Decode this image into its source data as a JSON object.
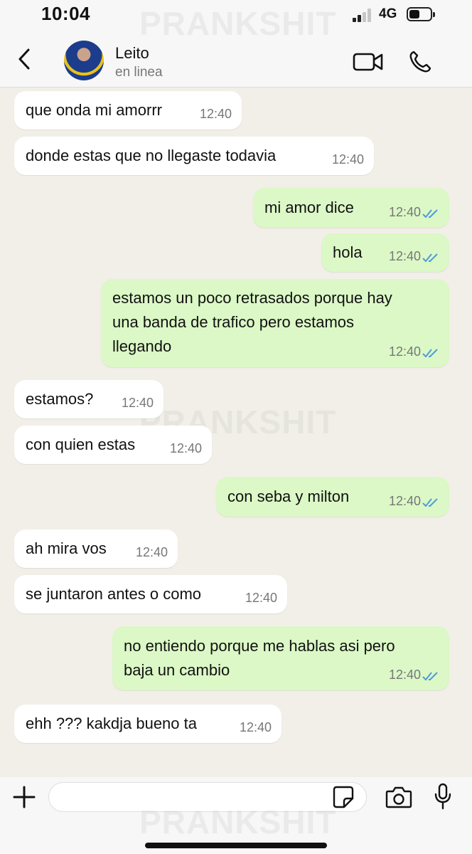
{
  "status_bar": {
    "time": "10:04",
    "network": "4G"
  },
  "header": {
    "contact_name": "Leito",
    "presence": "en linea"
  },
  "watermark": "PRANKSHIT",
  "messages": [
    {
      "dir": "in",
      "text": "que onda mi amorrr",
      "time": "12:40"
    },
    {
      "dir": "in",
      "text": "donde estas que no llegaste todavia",
      "time": "12:40"
    },
    {
      "dir": "out",
      "text": "mi amor dice",
      "time": "12:40",
      "read": true
    },
    {
      "dir": "out",
      "text": "hola",
      "time": "12:40",
      "read": true
    },
    {
      "dir": "out",
      "lines": [
        "estamos un poco retrasados porque hay",
        "una banda de trafico pero estamos",
        "llegando"
      ],
      "time": "12:40",
      "read": true
    },
    {
      "dir": "in",
      "text": "estamos?",
      "time": "12:40"
    },
    {
      "dir": "in",
      "text": "con quien estas",
      "time": "12:40"
    },
    {
      "dir": "out",
      "text": "con seba y milton",
      "time": "12:40",
      "read": true
    },
    {
      "dir": "in",
      "text": "ah mira vos",
      "time": "12:40"
    },
    {
      "dir": "in",
      "text": "se juntaron antes o como",
      "time": "12:40"
    },
    {
      "dir": "out",
      "lines": [
        "no entiendo porque me hablas asi pero",
        "baja un cambio"
      ],
      "time": "12:40",
      "read": true
    },
    {
      "dir": "in",
      "text": "ehh ??? kakdja bueno ta",
      "time": "12:40"
    }
  ],
  "colors": {
    "incoming_bubble": "#ffffff",
    "outgoing_bubble": "#dbf8c6",
    "read_ticks": "#4f9bd9",
    "chat_background": "#f2efe8"
  },
  "icons": {
    "back": "chevron-left-icon",
    "video": "video-camera-icon",
    "call": "phone-icon",
    "attach": "plus-icon",
    "sticker": "sticker-icon",
    "camera": "camera-icon",
    "mic": "microphone-icon"
  }
}
